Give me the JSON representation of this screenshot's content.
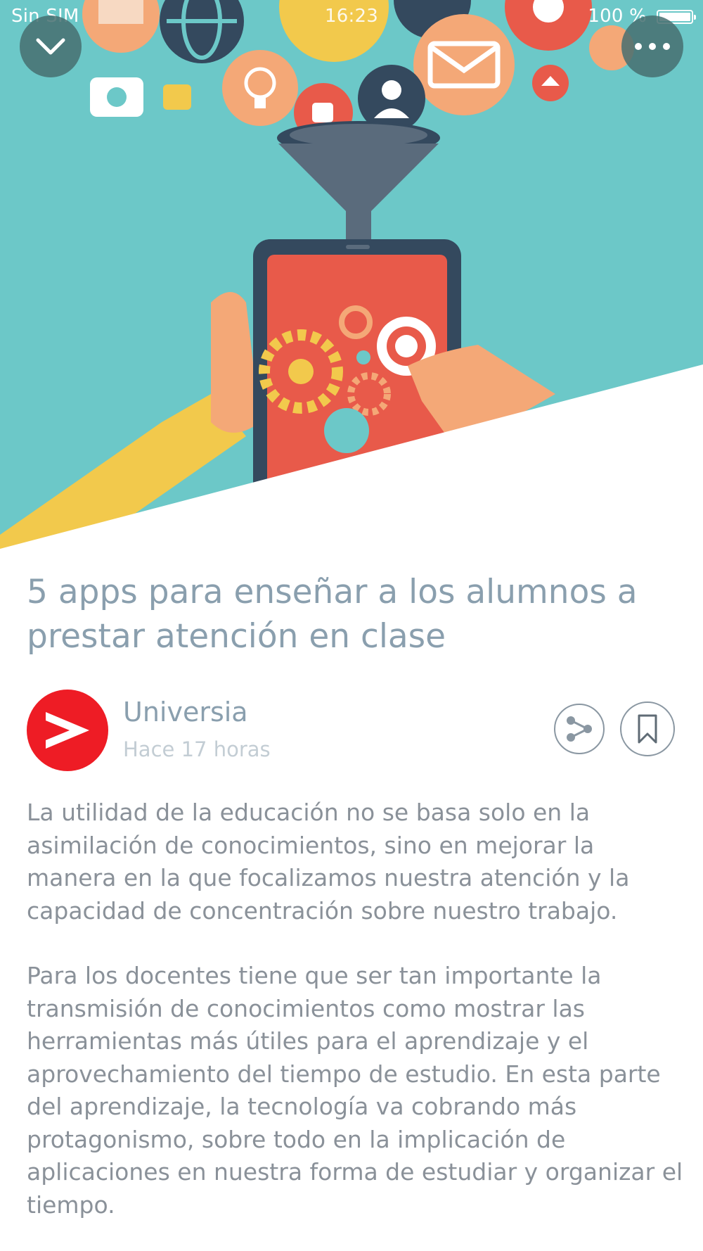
{
  "status_bar": {
    "carrier": "Sin SIM",
    "time": "16:23",
    "battery": "100 %"
  },
  "hero": {
    "illustration": "apps-funnel-into-smartphone",
    "background_color": "#6cc8c8"
  },
  "toolbar": {
    "collapse_icon": "chevron-down-icon",
    "more_icon": "ellipsis-icon"
  },
  "article": {
    "title": "5 apps para enseñar a los alumnos a prestar atención en clase",
    "source": {
      "name": "Universia",
      "time": "Hace 17 horas",
      "logo_color": "#ee1c25"
    },
    "actions": {
      "share_icon": "share-icon",
      "bookmark_icon": "bookmark-icon"
    },
    "paragraphs": [
      "La utilidad de la educación no se basa solo en la asimilación de conocimientos, sino en mejorar la manera en la que focalizamos nuestra atención y la capacidad de concentración sobre nuestro trabajo.",
      "Para los docentes tiene que ser tan importante la transmisión de conocimientos como mostrar las herramientas más útiles para el aprendizaje y el aprovechamiento del tiempo de estudio. En esta parte del aprendizaje, la tecnología va cobrando más protagonismo, sobre todo en la implicación de aplicaciones en nuestra forma de estudiar y organizar el tiempo."
    ]
  }
}
